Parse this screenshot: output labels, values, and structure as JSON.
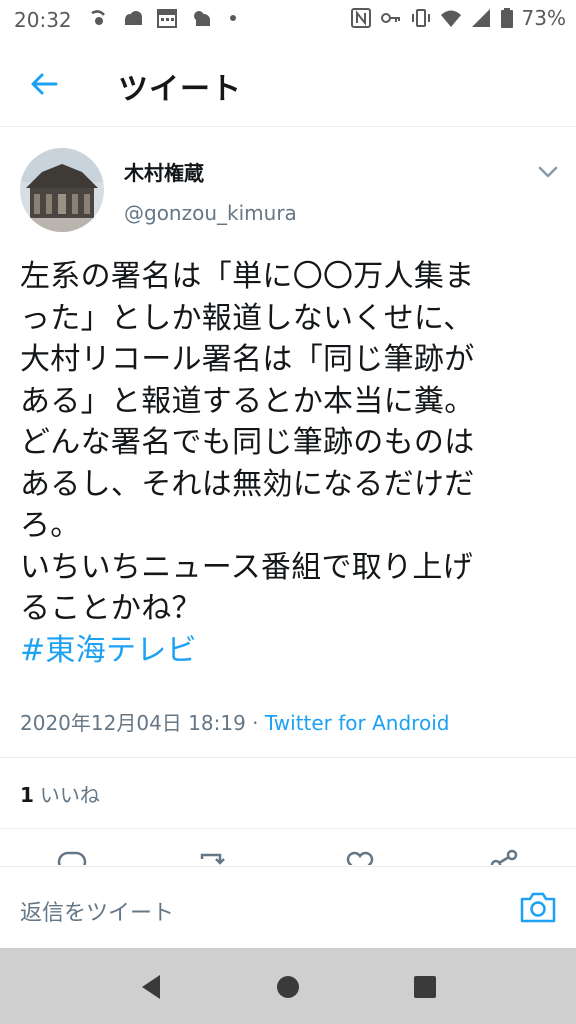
{
  "status_bar": {
    "time": "20:32",
    "battery": "73%",
    "icons_left": [
      "sync-icon",
      "cloud-icon",
      "calendar-icon",
      "weather-icon",
      "dot-icon"
    ],
    "icons_right": [
      "nfc-icon",
      "key-icon",
      "vibrate-icon",
      "wifi-icon",
      "signal-icon",
      "battery-icon"
    ]
  },
  "header": {
    "title": "ツイート",
    "back_icon": "arrow-left-icon"
  },
  "tweet": {
    "author_name": "木村権蔵",
    "author_handle": "@gonzou_kimura",
    "text_lines": [
      "左系の署名は「単に〇〇万人集ま",
      "った」としか報道しないくせに、",
      "大村リコール署名は「同じ筆跡が",
      "ある」と報道するとか本当に糞。",
      "どんな署名でも同じ筆跡のものは",
      "あるし、それは無効になるだけだ",
      "ろ。",
      "いちいちニュース番組で取り上げ",
      "ることかね？"
    ],
    "hashtag": "#東海テレビ",
    "timestamp": "2020年12月04日 18:19",
    "separator": "·",
    "source": "Twitter for Android",
    "likes_count": "1",
    "likes_label": "いいね"
  },
  "actions": [
    "reply-icon",
    "retweet-icon",
    "like-icon",
    "share-icon"
  ],
  "reply_bar": {
    "placeholder": "返信をツイート",
    "camera_icon": "camera-icon"
  },
  "nav_bar": [
    "back-triangle-icon",
    "home-circle-icon",
    "recents-square-icon"
  ],
  "colors": {
    "accent": "#1da1f2",
    "secondary_text": "#657786",
    "nav_bg": "#cfcfcf"
  }
}
